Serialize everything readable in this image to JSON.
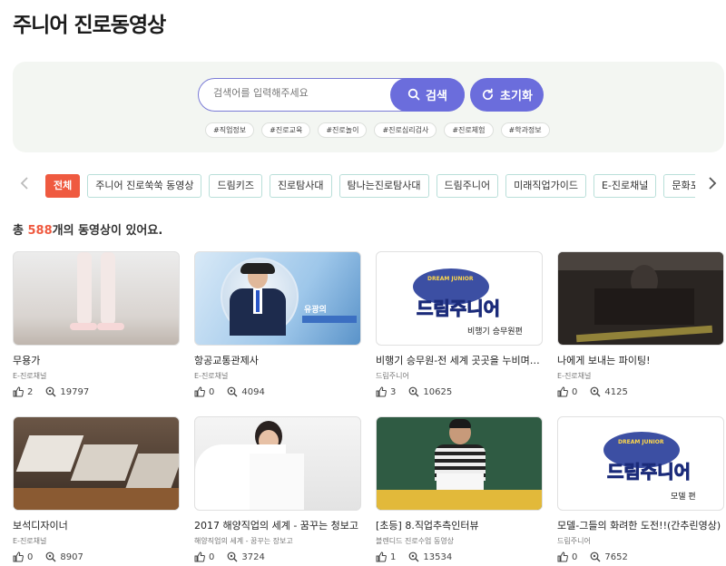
{
  "page": {
    "title": "주니어 진로동영상"
  },
  "search": {
    "placeholder": "검색어를 입력해주세요",
    "search_label": "검색",
    "reset_label": "초기화",
    "tags": [
      "#직업정보",
      "#진로교육",
      "#진로놀이",
      "#진로심리검사",
      "#진로체험",
      "#학과정보"
    ]
  },
  "categories": {
    "items": [
      "전체",
      "주니어 진로쑥쑥 동영상",
      "드림키즈",
      "진로탐사대",
      "탐나는진로탐사대",
      "드림주니어",
      "미래직업가이드",
      "E-진로채널",
      "문화포털 돋"
    ],
    "active_index": 0
  },
  "summary": {
    "prefix": "총 ",
    "count": "588",
    "suffix": "개의 동영상이 있어요."
  },
  "videos": [
    {
      "title": "무용가",
      "channel": "E-진로채널",
      "likes": "2",
      "views": "19797",
      "thumb_text": ""
    },
    {
      "title": "항공교통관제사",
      "channel": "E-진로채널",
      "likes": "0",
      "views": "4094",
      "thumb_text": "유광의"
    },
    {
      "title": "비행기 승무원-전 세계 곳곳을 누비며 국…",
      "channel": "드림주니어",
      "likes": "3",
      "views": "10625",
      "thumb_text": "비행기 승무원편"
    },
    {
      "title": "나에게 보내는 파이팅!",
      "channel": "E-진로채널",
      "likes": "0",
      "views": "4125",
      "thumb_text": ""
    },
    {
      "title": "보석디자이너",
      "channel": "E-진로채널",
      "likes": "0",
      "views": "8907",
      "thumb_text": ""
    },
    {
      "title": "2017 해양직업의 세계 - 꿈꾸는 청보고",
      "channel": "해양직업의 세계 - 꿈꾸는 장보고",
      "likes": "0",
      "views": "3724",
      "thumb_text": ""
    },
    {
      "title": "[초등] 8.직업추측인터뷰",
      "channel": "블렌디드 진로수업 동영상",
      "likes": "1",
      "views": "13534",
      "thumb_text": ""
    },
    {
      "title": "모델-그들의 화려한 도전!!(간추린영상)",
      "channel": "드림주니어",
      "likes": "0",
      "views": "7652",
      "thumb_text": "모델 편"
    }
  ],
  "logo": {
    "text": "드림주니어",
    "tagline": "DREAM JUNIOR"
  },
  "colors": {
    "accent": "#6b6ddc",
    "active_category": "#ef5a40",
    "category_border": "#b9dfd9",
    "panel_bg": "#f3f6f2"
  },
  "icons": {
    "search": "search-icon",
    "reset": "refresh-icon",
    "like": "thumbs-up-icon",
    "views": "search-view-icon",
    "prev": "chevron-left-icon",
    "next": "chevron-right-icon"
  }
}
